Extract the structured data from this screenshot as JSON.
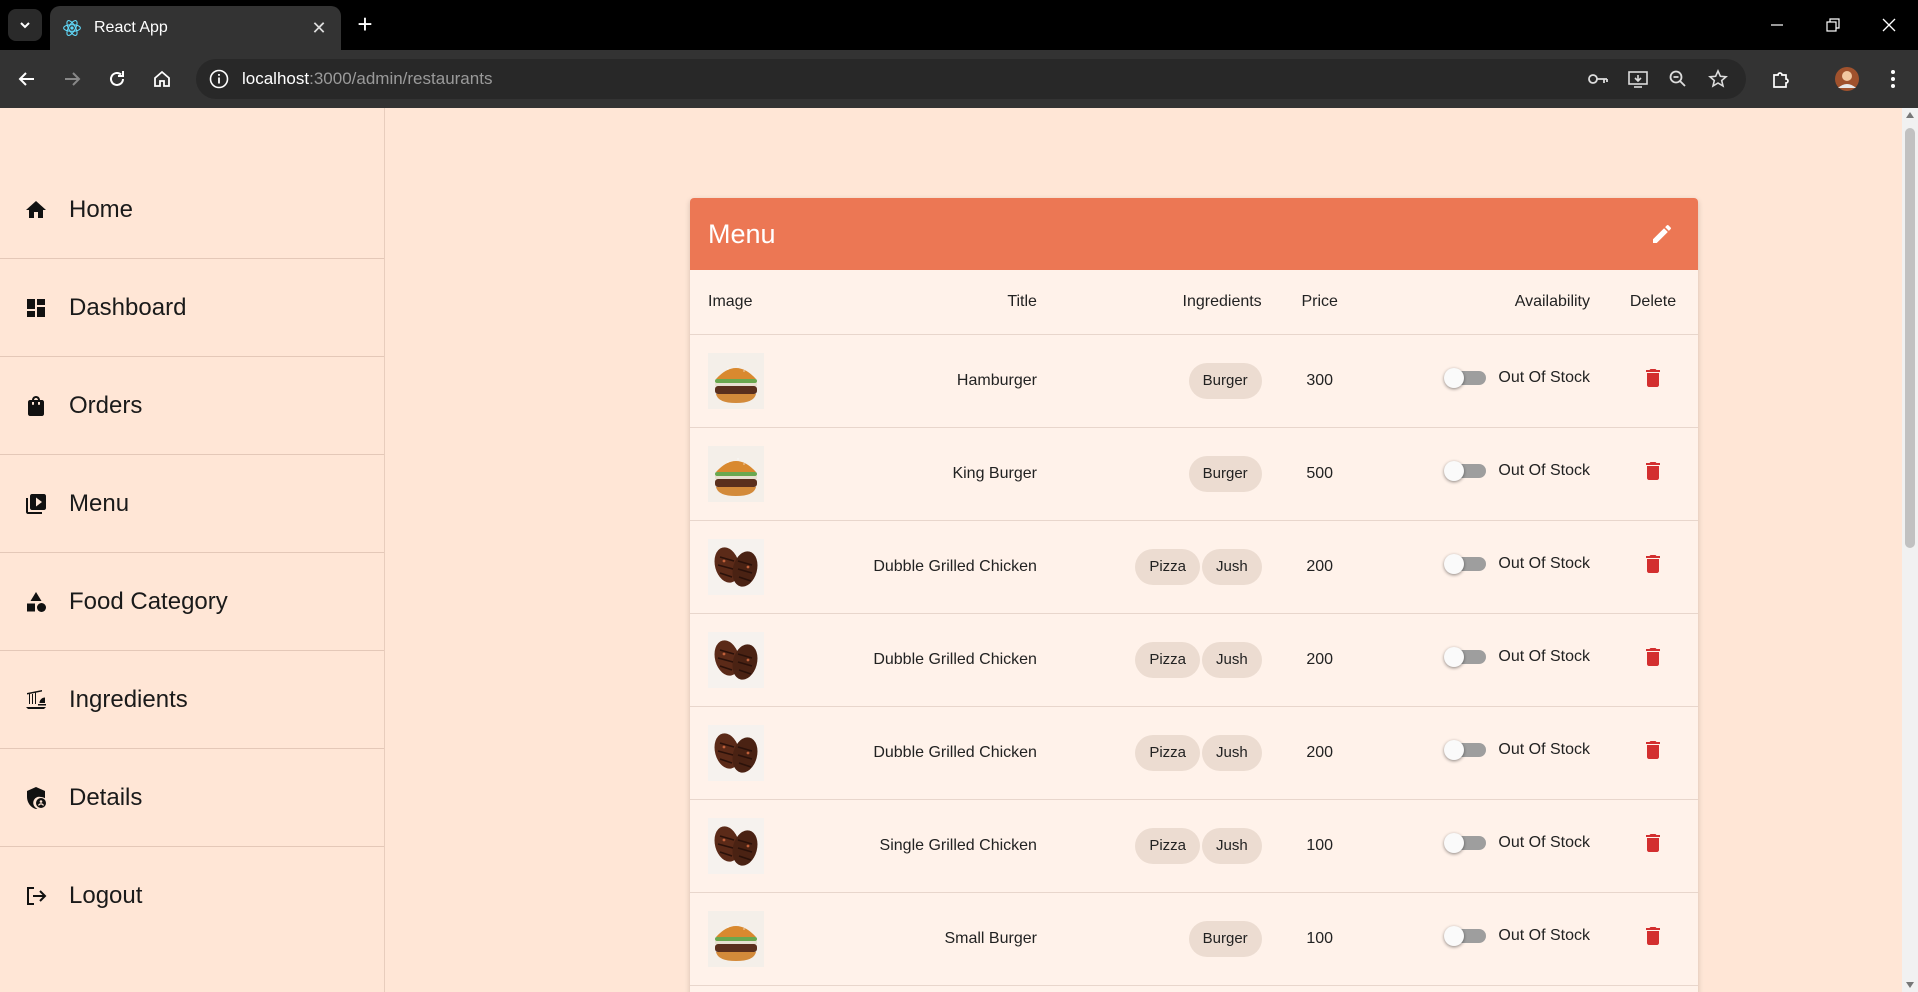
{
  "browser": {
    "tab_title": "React App",
    "url_host": "localhost",
    "url_rest": ":3000/admin/restaurants"
  },
  "sidebar": {
    "items": [
      {
        "label": "Home",
        "icon": "home-icon"
      },
      {
        "label": "Dashboard",
        "icon": "dashboard-icon"
      },
      {
        "label": "Orders",
        "icon": "shopping-bag-icon"
      },
      {
        "label": "Menu",
        "icon": "menu-book-icon"
      },
      {
        "label": "Food Category",
        "icon": "category-icon"
      },
      {
        "label": "Ingredients",
        "icon": "dinner-dining-icon"
      },
      {
        "label": "Details",
        "icon": "admin-shield-icon"
      },
      {
        "label": "Logout",
        "icon": "logout-icon"
      }
    ]
  },
  "menu_card": {
    "title": "Menu",
    "columns": {
      "image": "Image",
      "title": "Title",
      "ingredients": "Ingredients",
      "price": "Price",
      "availability": "Availability",
      "delete": "Delete"
    },
    "rows": [
      {
        "image": "burger",
        "title": "Hamburger",
        "ingredients": [
          "Burger"
        ],
        "price": "300",
        "availability": "Out Of Stock"
      },
      {
        "image": "burger",
        "title": "King Burger",
        "ingredients": [
          "Burger"
        ],
        "price": "500",
        "availability": "Out Of Stock"
      },
      {
        "image": "grilled-chicken",
        "title": "Dubble Grilled Chicken",
        "ingredients": [
          "Pizza",
          "Jush"
        ],
        "price": "200",
        "availability": "Out Of Stock"
      },
      {
        "image": "grilled-chicken",
        "title": "Dubble Grilled Chicken",
        "ingredients": [
          "Pizza",
          "Jush"
        ],
        "price": "200",
        "availability": "Out Of Stock"
      },
      {
        "image": "grilled-chicken",
        "title": "Dubble Grilled Chicken",
        "ingredients": [
          "Pizza",
          "Jush"
        ],
        "price": "200",
        "availability": "Out Of Stock"
      },
      {
        "image": "grilled-chicken",
        "title": "Single Grilled Chicken",
        "ingredients": [
          "Pizza",
          "Jush"
        ],
        "price": "100",
        "availability": "Out Of Stock"
      },
      {
        "image": "burger",
        "title": "Small Burger",
        "ingredients": [
          "Burger"
        ],
        "price": "100",
        "availability": "Out Of Stock"
      }
    ]
  },
  "colors": {
    "accent": "#ec7754",
    "background": "#ffe6d6",
    "delete": "#d32f2f"
  }
}
